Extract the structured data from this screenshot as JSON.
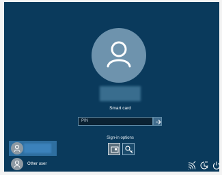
{
  "lock_screen": {
    "background": "#0a3a5c",
    "avatar_icon": "user-icon",
    "smart_card_label": "Smart card",
    "pin_placeholder": "PIN",
    "submit_icon": "arrow-right-icon",
    "sign_in_options_label": "Sign-in options",
    "sign_in_options": [
      {
        "name": "smart-card",
        "icon": "smart-card-icon",
        "selected": true
      },
      {
        "name": "key",
        "icon": "key-icon",
        "selected": false
      }
    ]
  },
  "user_switcher": {
    "users": [
      {
        "label": "",
        "icon": "user-icon",
        "active": true
      },
      {
        "label": "Other user",
        "icon": "user-icon",
        "active": false
      }
    ]
  },
  "system_tray": {
    "icons": [
      "network-icon",
      "ease-of-access-icon",
      "power-icon"
    ]
  }
}
